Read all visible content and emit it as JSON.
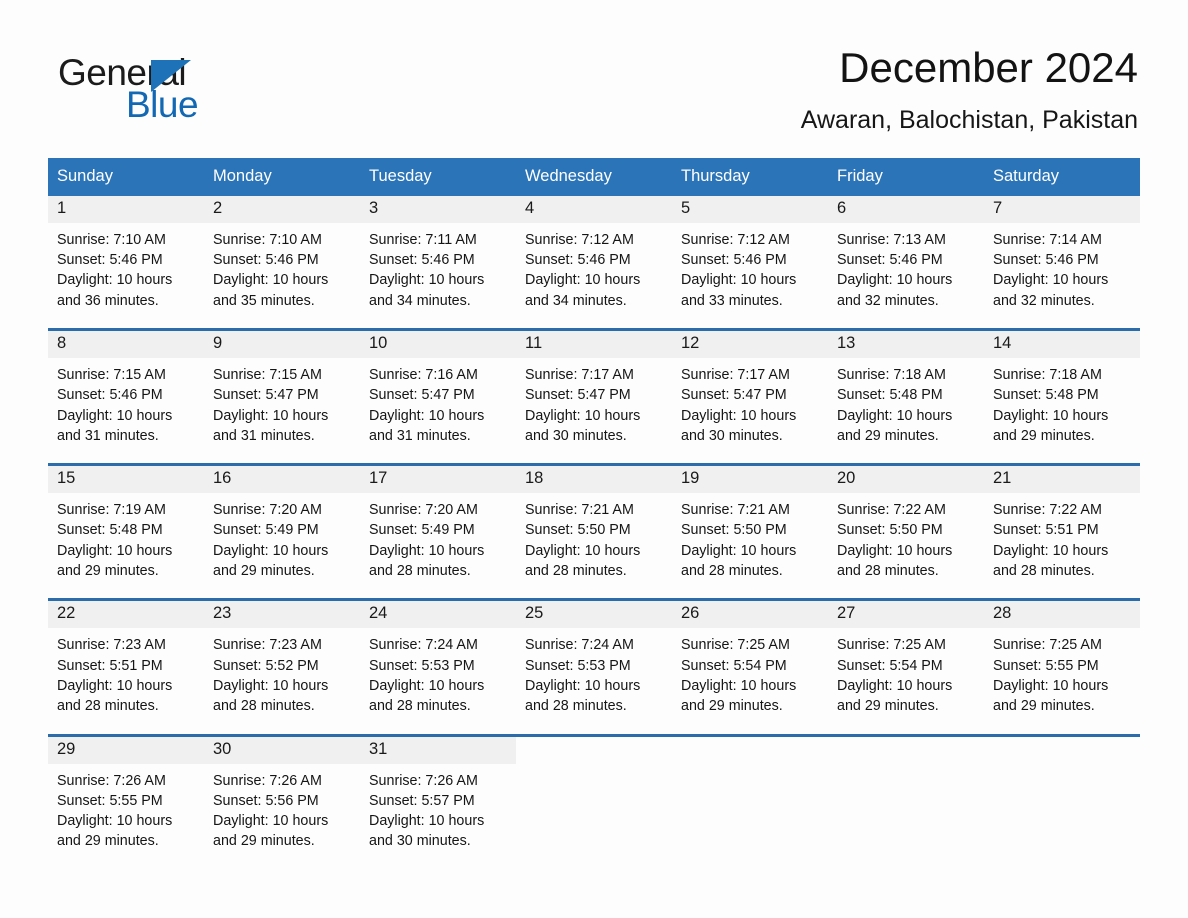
{
  "brand": {
    "name_part1": "General",
    "name_part2": "Blue",
    "logo_icon": "blue-triangle-flag-icon"
  },
  "header": {
    "title": "December 2024",
    "location": "Awaran, Balochistan, Pakistan"
  },
  "colors": {
    "header_blue": "#2b74b8",
    "row_divider_blue": "#2b6cab",
    "daynum_band": "#f0f0f0",
    "brand_blue": "#1268b3",
    "page_background": "#fdfdfd"
  },
  "weekdays": [
    "Sunday",
    "Monday",
    "Tuesday",
    "Wednesday",
    "Thursday",
    "Friday",
    "Saturday"
  ],
  "weeks": [
    [
      {
        "day": "1",
        "sunrise": "Sunrise: 7:10 AM",
        "sunset": "Sunset: 5:46 PM",
        "daylight1": "Daylight: 10 hours",
        "daylight2": "and 36 minutes."
      },
      {
        "day": "2",
        "sunrise": "Sunrise: 7:10 AM",
        "sunset": "Sunset: 5:46 PM",
        "daylight1": "Daylight: 10 hours",
        "daylight2": "and 35 minutes."
      },
      {
        "day": "3",
        "sunrise": "Sunrise: 7:11 AM",
        "sunset": "Sunset: 5:46 PM",
        "daylight1": "Daylight: 10 hours",
        "daylight2": "and 34 minutes."
      },
      {
        "day": "4",
        "sunrise": "Sunrise: 7:12 AM",
        "sunset": "Sunset: 5:46 PM",
        "daylight1": "Daylight: 10 hours",
        "daylight2": "and 34 minutes."
      },
      {
        "day": "5",
        "sunrise": "Sunrise: 7:12 AM",
        "sunset": "Sunset: 5:46 PM",
        "daylight1": "Daylight: 10 hours",
        "daylight2": "and 33 minutes."
      },
      {
        "day": "6",
        "sunrise": "Sunrise: 7:13 AM",
        "sunset": "Sunset: 5:46 PM",
        "daylight1": "Daylight: 10 hours",
        "daylight2": "and 32 minutes."
      },
      {
        "day": "7",
        "sunrise": "Sunrise: 7:14 AM",
        "sunset": "Sunset: 5:46 PM",
        "daylight1": "Daylight: 10 hours",
        "daylight2": "and 32 minutes."
      }
    ],
    [
      {
        "day": "8",
        "sunrise": "Sunrise: 7:15 AM",
        "sunset": "Sunset: 5:46 PM",
        "daylight1": "Daylight: 10 hours",
        "daylight2": "and 31 minutes."
      },
      {
        "day": "9",
        "sunrise": "Sunrise: 7:15 AM",
        "sunset": "Sunset: 5:47 PM",
        "daylight1": "Daylight: 10 hours",
        "daylight2": "and 31 minutes."
      },
      {
        "day": "10",
        "sunrise": "Sunrise: 7:16 AM",
        "sunset": "Sunset: 5:47 PM",
        "daylight1": "Daylight: 10 hours",
        "daylight2": "and 31 minutes."
      },
      {
        "day": "11",
        "sunrise": "Sunrise: 7:17 AM",
        "sunset": "Sunset: 5:47 PM",
        "daylight1": "Daylight: 10 hours",
        "daylight2": "and 30 minutes."
      },
      {
        "day": "12",
        "sunrise": "Sunrise: 7:17 AM",
        "sunset": "Sunset: 5:47 PM",
        "daylight1": "Daylight: 10 hours",
        "daylight2": "and 30 minutes."
      },
      {
        "day": "13",
        "sunrise": "Sunrise: 7:18 AM",
        "sunset": "Sunset: 5:48 PM",
        "daylight1": "Daylight: 10 hours",
        "daylight2": "and 29 minutes."
      },
      {
        "day": "14",
        "sunrise": "Sunrise: 7:18 AM",
        "sunset": "Sunset: 5:48 PM",
        "daylight1": "Daylight: 10 hours",
        "daylight2": "and 29 minutes."
      }
    ],
    [
      {
        "day": "15",
        "sunrise": "Sunrise: 7:19 AM",
        "sunset": "Sunset: 5:48 PM",
        "daylight1": "Daylight: 10 hours",
        "daylight2": "and 29 minutes."
      },
      {
        "day": "16",
        "sunrise": "Sunrise: 7:20 AM",
        "sunset": "Sunset: 5:49 PM",
        "daylight1": "Daylight: 10 hours",
        "daylight2": "and 29 minutes."
      },
      {
        "day": "17",
        "sunrise": "Sunrise: 7:20 AM",
        "sunset": "Sunset: 5:49 PM",
        "daylight1": "Daylight: 10 hours",
        "daylight2": "and 28 minutes."
      },
      {
        "day": "18",
        "sunrise": "Sunrise: 7:21 AM",
        "sunset": "Sunset: 5:50 PM",
        "daylight1": "Daylight: 10 hours",
        "daylight2": "and 28 minutes."
      },
      {
        "day": "19",
        "sunrise": "Sunrise: 7:21 AM",
        "sunset": "Sunset: 5:50 PM",
        "daylight1": "Daylight: 10 hours",
        "daylight2": "and 28 minutes."
      },
      {
        "day": "20",
        "sunrise": "Sunrise: 7:22 AM",
        "sunset": "Sunset: 5:50 PM",
        "daylight1": "Daylight: 10 hours",
        "daylight2": "and 28 minutes."
      },
      {
        "day": "21",
        "sunrise": "Sunrise: 7:22 AM",
        "sunset": "Sunset: 5:51 PM",
        "daylight1": "Daylight: 10 hours",
        "daylight2": "and 28 minutes."
      }
    ],
    [
      {
        "day": "22",
        "sunrise": "Sunrise: 7:23 AM",
        "sunset": "Sunset: 5:51 PM",
        "daylight1": "Daylight: 10 hours",
        "daylight2": "and 28 minutes."
      },
      {
        "day": "23",
        "sunrise": "Sunrise: 7:23 AM",
        "sunset": "Sunset: 5:52 PM",
        "daylight1": "Daylight: 10 hours",
        "daylight2": "and 28 minutes."
      },
      {
        "day": "24",
        "sunrise": "Sunrise: 7:24 AM",
        "sunset": "Sunset: 5:53 PM",
        "daylight1": "Daylight: 10 hours",
        "daylight2": "and 28 minutes."
      },
      {
        "day": "25",
        "sunrise": "Sunrise: 7:24 AM",
        "sunset": "Sunset: 5:53 PM",
        "daylight1": "Daylight: 10 hours",
        "daylight2": "and 28 minutes."
      },
      {
        "day": "26",
        "sunrise": "Sunrise: 7:25 AM",
        "sunset": "Sunset: 5:54 PM",
        "daylight1": "Daylight: 10 hours",
        "daylight2": "and 29 minutes."
      },
      {
        "day": "27",
        "sunrise": "Sunrise: 7:25 AM",
        "sunset": "Sunset: 5:54 PM",
        "daylight1": "Daylight: 10 hours",
        "daylight2": "and 29 minutes."
      },
      {
        "day": "28",
        "sunrise": "Sunrise: 7:25 AM",
        "sunset": "Sunset: 5:55 PM",
        "daylight1": "Daylight: 10 hours",
        "daylight2": "and 29 minutes."
      }
    ],
    [
      {
        "day": "29",
        "sunrise": "Sunrise: 7:26 AM",
        "sunset": "Sunset: 5:55 PM",
        "daylight1": "Daylight: 10 hours",
        "daylight2": "and 29 minutes."
      },
      {
        "day": "30",
        "sunrise": "Sunrise: 7:26 AM",
        "sunset": "Sunset: 5:56 PM",
        "daylight1": "Daylight: 10 hours",
        "daylight2": "and 29 minutes."
      },
      {
        "day": "31",
        "sunrise": "Sunrise: 7:26 AM",
        "sunset": "Sunset: 5:57 PM",
        "daylight1": "Daylight: 10 hours",
        "daylight2": "and 30 minutes."
      },
      {
        "day": "",
        "sunrise": "",
        "sunset": "",
        "daylight1": "",
        "daylight2": ""
      },
      {
        "day": "",
        "sunrise": "",
        "sunset": "",
        "daylight1": "",
        "daylight2": ""
      },
      {
        "day": "",
        "sunrise": "",
        "sunset": "",
        "daylight1": "",
        "daylight2": ""
      },
      {
        "day": "",
        "sunrise": "",
        "sunset": "",
        "daylight1": "",
        "daylight2": ""
      }
    ]
  ]
}
